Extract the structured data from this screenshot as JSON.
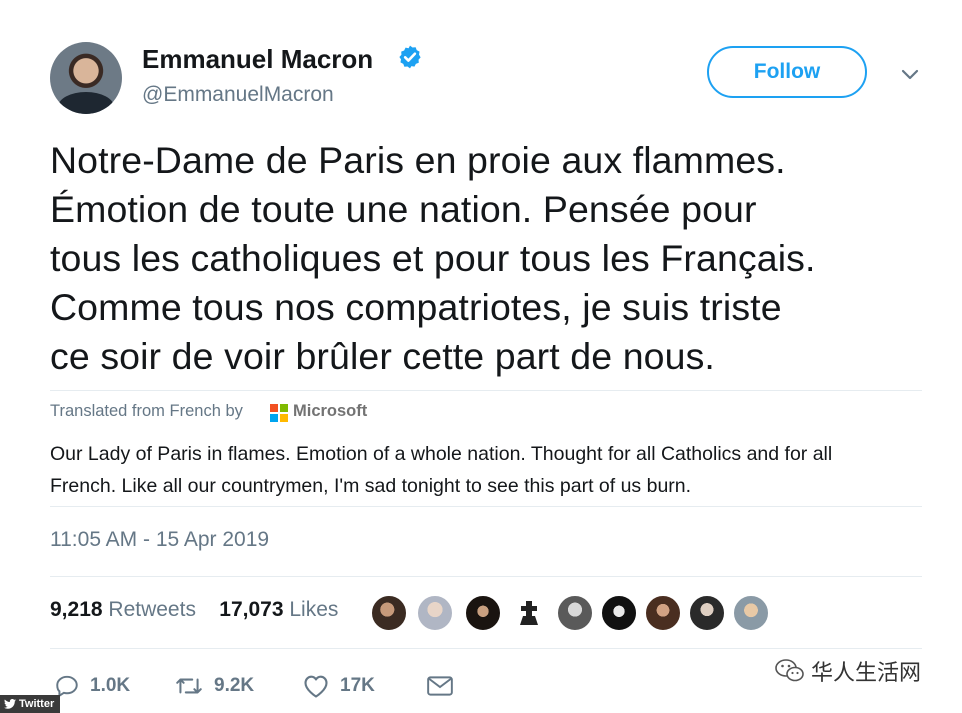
{
  "author": {
    "name": "Emmanuel Macron",
    "handle": "@EmmanuelMacron",
    "verified": true
  },
  "header": {
    "follow_label": "Follow"
  },
  "tweet": {
    "text_lines": [
      "Notre-Dame de Paris en proie aux flammes.",
      "Émotion de toute une nation. Pensée pour",
      "tous les catholiques et pour tous les Français.",
      "Comme tous nos compatriotes, je suis triste",
      "ce soir de voir brûler cette part de nous."
    ],
    "translated_label": "Translated from French by",
    "translator": "Microsoft",
    "translation_lines": [
      "Our Lady of Paris in flames. Emotion of a whole nation. Thought for all Catholics and for all",
      "French. Like all our countrymen, I'm sad tonight to see this part of us burn."
    ],
    "timestamp": "11:05 AM - 15 Apr 2019"
  },
  "stats": {
    "retweets_count": "9,218",
    "retweets_label": "Retweets",
    "likes_count": "17,073",
    "likes_label": "Likes"
  },
  "actions": {
    "reply_count": "1.0K",
    "retweet_count": "9.2K",
    "like_count": "17K"
  },
  "watermark": {
    "text": "华人生活网"
  },
  "badge": {
    "text": "Twitter"
  },
  "colors": {
    "accent": "#1da1f2",
    "text": "#14171a",
    "muted": "#657786",
    "divider": "#e6ecf0"
  },
  "icons": {
    "verified": "verified-badge-icon",
    "chevron": "chevron-down-icon",
    "reply": "reply-icon",
    "retweet": "retweet-icon",
    "like": "heart-icon",
    "dm": "envelope-icon"
  }
}
